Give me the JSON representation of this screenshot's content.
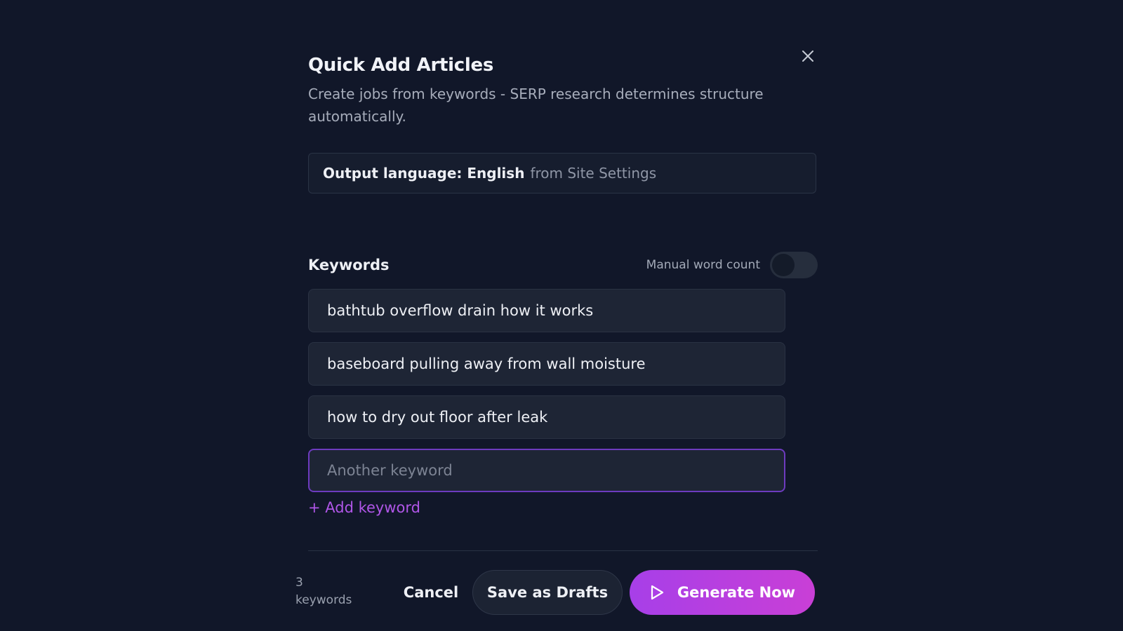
{
  "modal": {
    "title": "Quick Add Articles",
    "subtitle": "Create jobs from keywords - SERP research determines structure automatically."
  },
  "language": {
    "label": "Output language: English",
    "source": "from Site Settings"
  },
  "keywords": {
    "title": "Keywords",
    "manual_word_count_label": "Manual word count",
    "manual_word_count_enabled": false,
    "items": [
      "bathtub overflow drain how it works",
      "baseboard pulling away from wall moisture",
      "how to dry out floor after leak"
    ],
    "input_placeholder": "Another keyword",
    "add_label": "+ Add keyword"
  },
  "footer": {
    "count_number": "3",
    "count_label": "keywords",
    "cancel_label": "Cancel",
    "drafts_label": "Save as Drafts",
    "generate_label": "Generate Now"
  },
  "icons": {
    "close": "close-icon",
    "generate": "play-icon"
  },
  "colors": {
    "background": "#111729",
    "accent": "#b056e8",
    "generate_gradient_start": "#a73fe8",
    "generate_gradient_end": "#c93fd6"
  }
}
